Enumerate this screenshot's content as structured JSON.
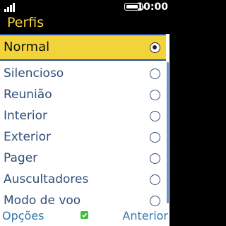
{
  "status_bar": {
    "time": "10:00",
    "battery_level": 0.8,
    "signal_strength": 4
  },
  "header": {
    "title": "Perfis"
  },
  "profiles": [
    {
      "label": "Normal",
      "selected": true
    },
    {
      "label": "Silencioso",
      "selected": false
    },
    {
      "label": "Reunião",
      "selected": false
    },
    {
      "label": "Interior",
      "selected": false
    },
    {
      "label": "Exterior",
      "selected": false
    },
    {
      "label": "Pager",
      "selected": false
    },
    {
      "label": "Auscultadores",
      "selected": false
    },
    {
      "label": "Modo de voo",
      "selected": false
    }
  ],
  "softkeys": {
    "left": "Opções",
    "center_icon": "check-icon",
    "right": "Anterior"
  },
  "colors": {
    "accent": "#f2d33a",
    "title": "#f5d33a",
    "text": "#2e4f7a",
    "softkey": "#2e78a8",
    "center_icon": "#3ebd3e"
  }
}
